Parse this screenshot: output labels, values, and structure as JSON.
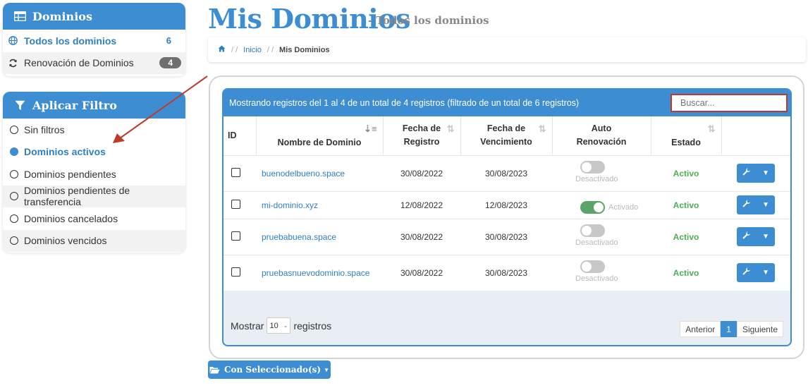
{
  "sidebar": {
    "domains_panel": {
      "title": "Dominios",
      "items": [
        {
          "label": "Todos los dominios",
          "count": "6"
        },
        {
          "label": "Renovación de Dominios",
          "count": "4"
        }
      ]
    },
    "filter_panel": {
      "title": "Aplicar Filtro",
      "options": [
        {
          "label": "Sin filtros"
        },
        {
          "label": "Dominios activos"
        },
        {
          "label": "Dominios pendientes"
        },
        {
          "label": "Dominios pendientes de transferencia"
        },
        {
          "label": "Dominios cancelados"
        },
        {
          "label": "Dominios vencidos"
        }
      ],
      "selected_index": 1
    }
  },
  "header": {
    "title": "Mis Dominios",
    "subtitle": "- Todos los dominios"
  },
  "breadcrumb": {
    "sep": "/ /",
    "link": "Inicio",
    "current": "Mis Dominios"
  },
  "table": {
    "info": "Mostrando registros del 1 al 4 de un total de 4 registros (filtrado de un total de 6 registros)",
    "search_placeholder": "Buscar...",
    "columns": {
      "id": "ID",
      "domain": "Nombre de Dominio",
      "reg_1": "Fecha de",
      "reg_2": "Registro",
      "exp_1": "Fecha de",
      "exp_2": "Vencimiento",
      "auto_1": "Auto",
      "auto_2": "Renovación",
      "status": "Estado"
    },
    "rows": [
      {
        "domain": "buenodelbueno.space",
        "registered": "30/08/2022",
        "expires": "30/08/2023",
        "auto": "Desactivado",
        "status": "Activo"
      },
      {
        "domain": "mi-dominio.xyz",
        "registered": "12/08/2022",
        "expires": "12/08/2023",
        "auto": "Activado",
        "status": "Activo"
      },
      {
        "domain": "pruebabuena.space",
        "registered": "30/08/2022",
        "expires": "30/08/2023",
        "auto": "Desactivado",
        "status": "Activo"
      },
      {
        "domain": "pruebasnuevodominio.space",
        "registered": "30/08/2022",
        "expires": "30/08/2023",
        "auto": "Desactivado",
        "status": "Activo"
      }
    ],
    "footer": {
      "show_label": "Mostrar",
      "page_size": "10",
      "records_label": "registros",
      "prev": "Anterior",
      "page": "1",
      "next": "Siguiente"
    }
  },
  "bulk_button": "Con Seleccionado(s)",
  "colors": {
    "accent": "#3d8dd3",
    "status_active": "#4caf50",
    "toggle_on": "#5aa469",
    "annotation_arrow": "#c0392b"
  }
}
